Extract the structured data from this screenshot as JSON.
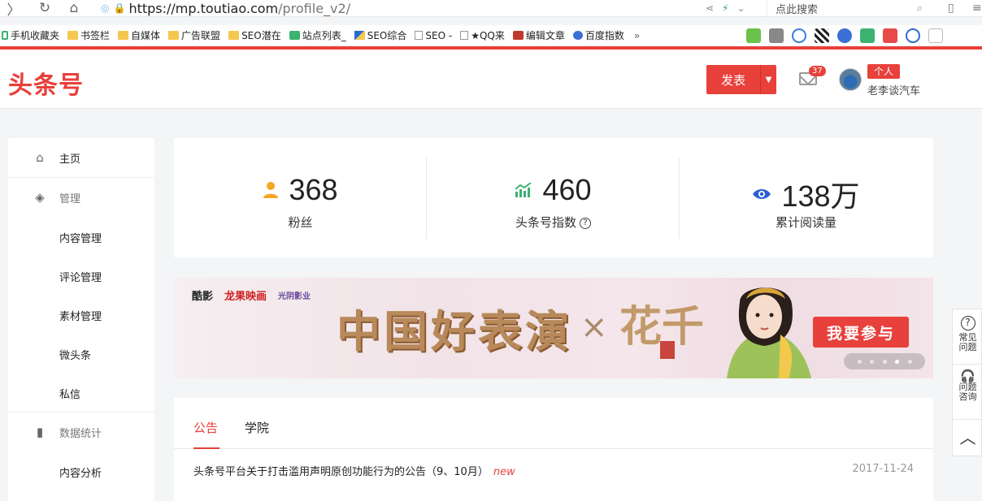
{
  "browser": {
    "url_host": "https://mp.toutiao.com",
    "url_path": "/profile_v2/",
    "search_placeholder": "点此搜索"
  },
  "bookmarks": [
    {
      "label": "手机收藏夹",
      "icon": "phone-icon"
    },
    {
      "label": "书签栏",
      "icon": "folder-icon"
    },
    {
      "label": "自媒体",
      "icon": "folder-icon"
    },
    {
      "label": "广告联盟",
      "icon": "folder-icon"
    },
    {
      "label": "SEO潜在",
      "icon": "folder-icon"
    },
    {
      "label": "站点列表_",
      "icon": "site-icon"
    },
    {
      "label": "SEO综合",
      "icon": "seo-icon"
    },
    {
      "label": "SEO -",
      "icon": "page-icon"
    },
    {
      "label": "★QQ来",
      "icon": "page-icon"
    },
    {
      "label": "编辑文章",
      "icon": "c-icon"
    },
    {
      "label": "百度指数",
      "icon": "baidu-icon"
    }
  ],
  "bookmarks_more": "»",
  "header": {
    "logo": "头条号",
    "publish_label": "发表",
    "mail_badge": "37",
    "role_tag": "个人",
    "username": "老李谈汽车"
  },
  "sidebar": {
    "home": "主页",
    "manage": "管理",
    "content_manage": "内容管理",
    "comment_manage": "评论管理",
    "material_manage": "素材管理",
    "micro_toutiao": "微头条",
    "private_msg": "私信",
    "data_stats": "数据统计",
    "content_analysis": "内容分析"
  },
  "stats": {
    "fans_value": "368",
    "fans_label": "粉丝",
    "index_value": "460",
    "index_label": "头条号指数",
    "reads_value": "138万",
    "reads_label": "累计阅读量"
  },
  "banner": {
    "logo1": "酷影",
    "logo2": "龙果映画",
    "logo3": "光阴影业",
    "title": "中国好表演",
    "x": "×",
    "subtitle": "花千",
    "cta": "我要参与",
    "slides": 5,
    "active_slide": 4
  },
  "notices": {
    "tab_announce": "公告",
    "tab_academy": "学院",
    "items": [
      {
        "title": "头条号平台关于打击滥用声明原创功能行为的公告（9、10月）",
        "tag": "new",
        "date": "2017-11-24"
      }
    ]
  },
  "float_panel": {
    "faq": "常见问题",
    "consult": "问题咨询"
  },
  "colors": {
    "brand_red": "#e8403b",
    "fans_icon": "#f5a623",
    "index_icon": "#3cb371",
    "reads_icon": "#2c5ed6"
  }
}
